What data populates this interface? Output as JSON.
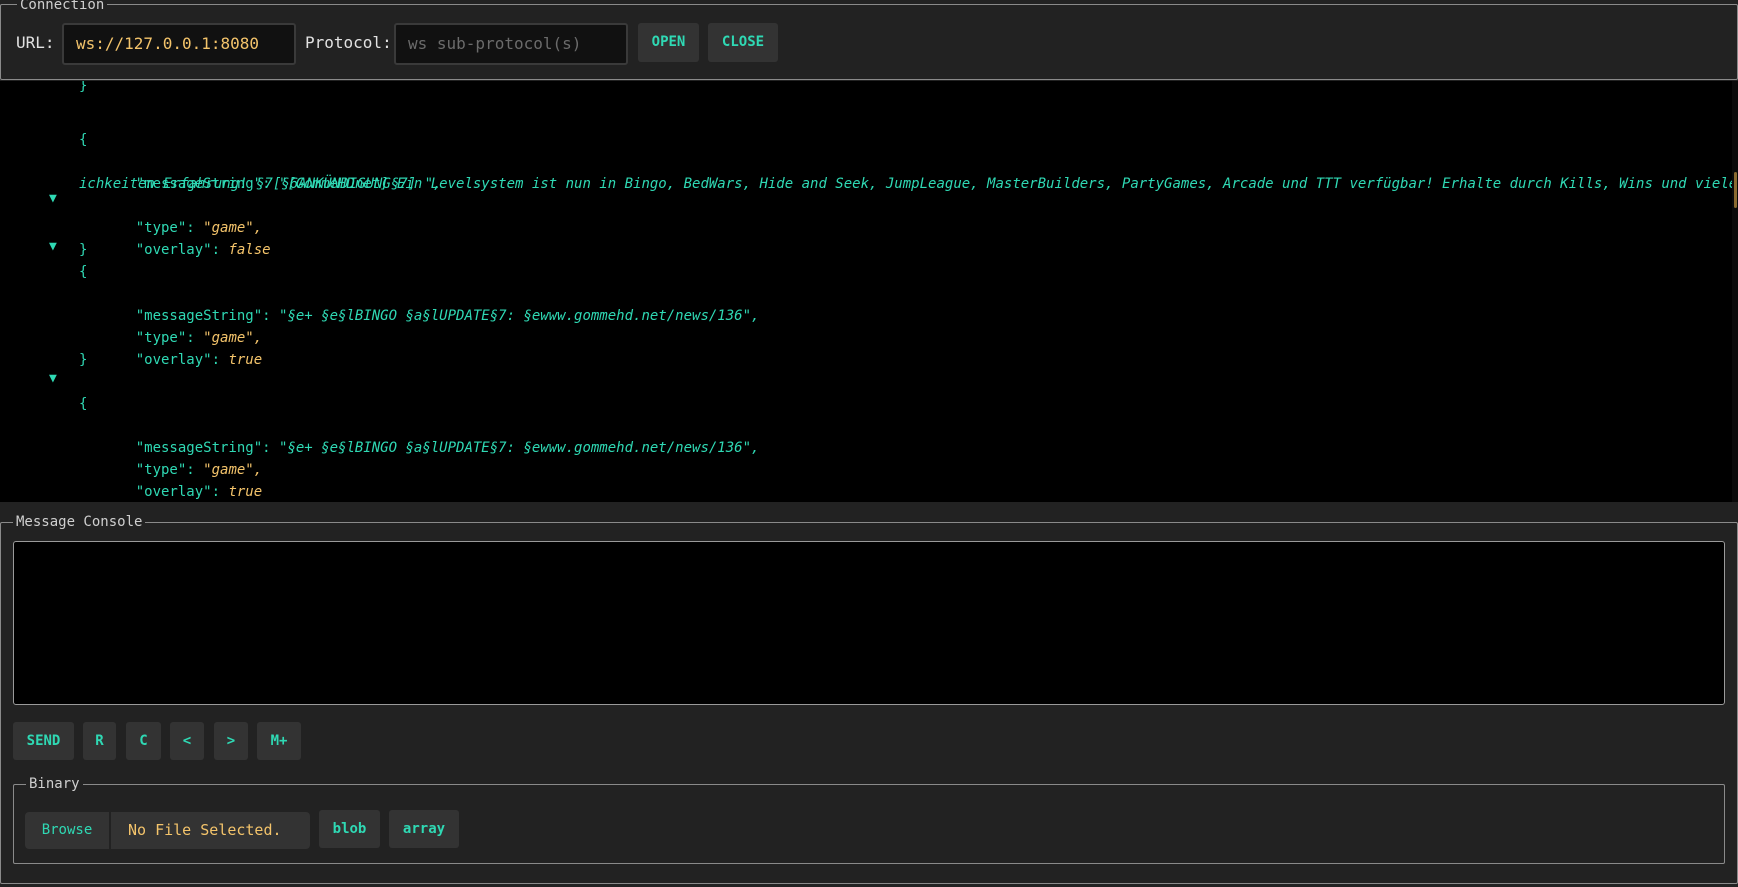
{
  "connection": {
    "legend": "Connection",
    "url_label": "URL:",
    "url_value": "ws://127.0.0.1:8080",
    "protocol_label": "Protocol:",
    "protocol_placeholder": "ws sub-protocol(s)",
    "open_label": "OPEN",
    "close_label": "CLOSE"
  },
  "log": {
    "messages": [
      {
        "messageString": "\"[GommeHDnet] Ein Levelsystem ist nun in Bingo, BedWars, Hide and Seek, JumpLeague, MasterBuilders, PartyGames, Arcade und TTT verfügbar! Erhalte durch Kills, Wins und viele weitere Mögl",
        "messageString_cont": "ichkeiten Erfahrung! §7[§6ANKÜNDIGUNG§7] \",",
        "type": "\"game\",",
        "overlay": "false"
      },
      {
        "messageString": "\"§e+ §e§lBINGO §a§lUPDATE§7: §ewww.gommehd.net/news/136\",",
        "type": "\"game\",",
        "overlay": "true"
      },
      {
        "messageString": "\"§e+ §e§lBINGO §a§lUPDATE§7: §ewww.gommehd.net/news/136\",",
        "type": "\"game\",",
        "overlay": "true"
      }
    ],
    "keys": {
      "messageString": "\"messageString\": ",
      "type": "\"type\": ",
      "overlay": "\"overlay\": "
    },
    "brace_open": "{",
    "brace_close": "}",
    "toggle_glyph": "▼"
  },
  "console": {
    "legend": "Message Console",
    "input_value": "",
    "buttons": {
      "send": "SEND",
      "r": "R",
      "c": "C",
      "prev": "<",
      "next": ">",
      "mplus": "M+"
    }
  },
  "binary": {
    "legend": "Binary",
    "browse_label": "Browse",
    "file_status": "No File Selected.",
    "blob_label": "blob",
    "array_label": "array"
  },
  "colors": {
    "accent": "#2fd9b4",
    "value": "#f4c46b",
    "background": "#222222",
    "log_background": "#000000"
  }
}
